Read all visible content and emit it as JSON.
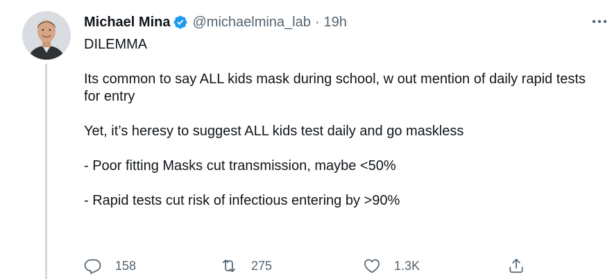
{
  "author": {
    "name": "Michael Mina",
    "handle": "@michaelmina_lab",
    "separator": "·",
    "time": "19h",
    "verified": true
  },
  "tweet": {
    "paragraphs": [
      "DILEMMA",
      "Its common to say ALL kids mask during school, w out mention of daily rapid tests for entry",
      "Yet, it’s heresy to suggest ALL kids test daily and go maskless",
      "- Poor fitting Masks cut transmission, maybe <50%",
      "- Rapid tests cut risk of infectious entering by >90%"
    ]
  },
  "actions": {
    "replies": "158",
    "retweets": "275",
    "likes": "1.3K"
  },
  "icons": {
    "more": "more-horizontal-icon",
    "verified": "verified-badge-icon",
    "reply": "reply-icon",
    "retweet": "retweet-icon",
    "like": "heart-icon",
    "share": "share-icon"
  },
  "colors": {
    "text": "#0f1419",
    "secondary": "#536471",
    "verified": "#1d9bf0",
    "thread_line": "#cfd9de"
  }
}
